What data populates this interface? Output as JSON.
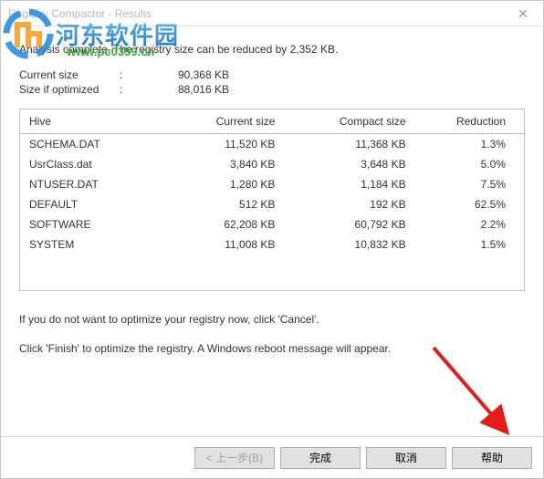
{
  "window": {
    "title": "Registry Compactor - Results"
  },
  "summary": "Analysis complete. The registry size can be reduced by 2,352 KB.",
  "stats": {
    "current_label": "Current size",
    "current_value": "90,368 KB",
    "optimized_label": "Size if optimized",
    "optimized_value": "88,016 KB"
  },
  "table": {
    "headers": {
      "hive": "Hive",
      "current": "Current size",
      "compact": "Compact size",
      "reduction": "Reduction"
    },
    "rows": [
      {
        "hive": "SCHEMA.DAT",
        "current": "11,520 KB",
        "compact": "11,368 KB",
        "reduction": "1.3%"
      },
      {
        "hive": "UsrClass.dat",
        "current": "3,840 KB",
        "compact": "3,648 KB",
        "reduction": "5.0%"
      },
      {
        "hive": "NTUSER.DAT",
        "current": "1,280 KB",
        "compact": "1,184 KB",
        "reduction": "7.5%"
      },
      {
        "hive": "DEFAULT",
        "current": "512 KB",
        "compact": "192 KB",
        "reduction": "62.5%"
      },
      {
        "hive": "SOFTWARE",
        "current": "62,208 KB",
        "compact": "60,792 KB",
        "reduction": "2.2%"
      },
      {
        "hive": "SYSTEM",
        "current": "11,008 KB",
        "compact": "10,832 KB",
        "reduction": "1.5%"
      }
    ]
  },
  "hints": {
    "cancel": "If you do not want to optimize your registry now, click 'Cancel'.",
    "finish": "Click 'Finish' to optimize the registry. A Windows reboot message will appear."
  },
  "buttons": {
    "back": "< 上一步(B)",
    "finish": "完成",
    "cancel": "取消",
    "help": "帮助"
  },
  "watermark": {
    "cn": "河东软件园",
    "url": "www.pc0359.cn"
  }
}
